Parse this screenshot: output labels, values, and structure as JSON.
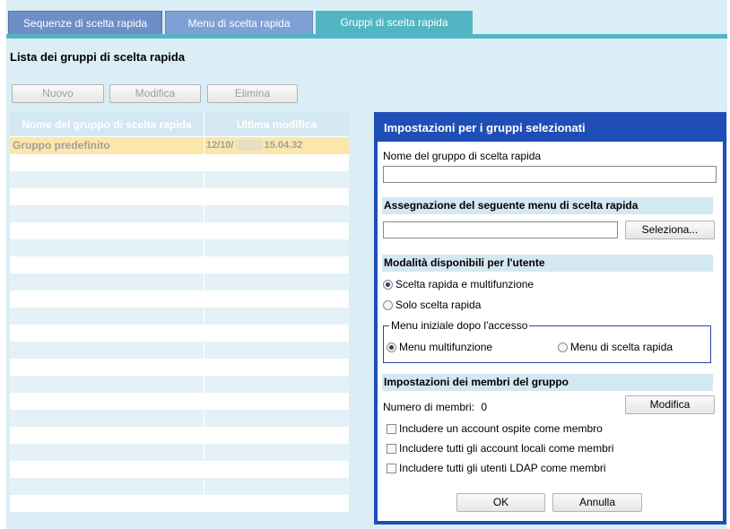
{
  "tabs": [
    {
      "label": "Sequenze di scelta rapida"
    },
    {
      "label": "Menu di scelta rapida"
    },
    {
      "label": "Gruppi di scelta rapida"
    }
  ],
  "list": {
    "title": "Lista dei gruppi di scelta rapida",
    "buttons": {
      "new": "Nuovo",
      "edit": "Modifica",
      "delete": "Elimina"
    },
    "columns": [
      "Nome del gruppo di scelta rapida",
      "Ultima modifica"
    ],
    "rows": [
      {
        "name": "Gruppo predefinito",
        "date_prefix": "12/10/",
        "time": "15.04.32"
      }
    ]
  },
  "panel": {
    "title": "Impostazioni per i gruppi selezionati",
    "name_label": "Nome del gruppo di scelta rapida",
    "name_value": "",
    "menu_section": "Assegnazione del seguente menu di scelta rapida",
    "menu_value": "",
    "select_button": "Seleziona...",
    "modes_section": "Modalità disponibili per l'utente",
    "mode_options": [
      "Scelta rapida e multifunzione",
      "Solo scelta rapida"
    ],
    "initial_menu_legend": "Menu iniziale dopo l'accesso",
    "initial_menu_options": [
      "Menu multifunzione",
      "Menu di scelta rapida"
    ],
    "members_section": "Impostazioni dei membri del gruppo",
    "members_count_label": "Numero di membri:",
    "members_count": "0",
    "members_edit_button": "Modifica",
    "checkboxes": [
      "Includere un account ospite come membro",
      "Includere tutti gli account locali come membri",
      "Includere tutti gli utenti LDAP come membri"
    ],
    "ok_button": "OK",
    "cancel_button": "Annulla"
  }
}
